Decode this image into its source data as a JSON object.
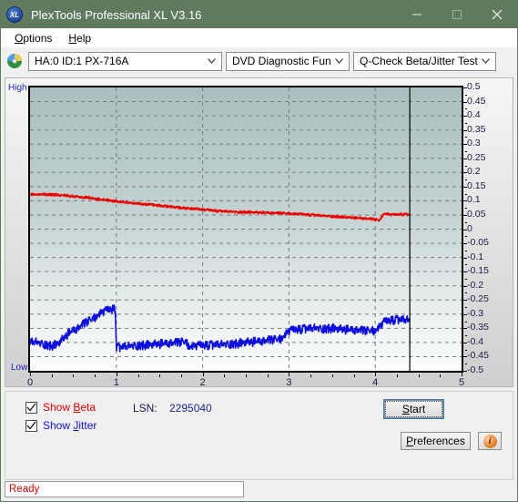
{
  "window": {
    "title": "PlexTools Professional XL V3.16",
    "app_icon": "xl-logo-icon",
    "minimize_label": "Minimize",
    "maximize_label": "Maximize",
    "close_label": "Close",
    "titlebar_color": "#5f7a5f"
  },
  "menu": {
    "items": [
      {
        "label": "Options",
        "accel": "O"
      },
      {
        "label": "Help",
        "accel": "H"
      }
    ]
  },
  "toolbar": {
    "drive_icon": "optical-disc-icon",
    "drive_select": {
      "value": "HA:0 ID:1  PX-716A"
    },
    "function_select": {
      "value": "DVD Diagnostic Functions"
    },
    "test_select": {
      "value": "Q-Check Beta/Jitter Test"
    },
    "arrow_glyph": "⌄"
  },
  "chart_data": {
    "type": "line",
    "title": "Q-Check Beta/Jitter Test",
    "xlabel": "",
    "ylabel": "",
    "xlim": [
      0,
      5
    ],
    "ylim": [
      -0.5,
      0.5
    ],
    "xticks": [
      0,
      1,
      2,
      3,
      4,
      5
    ],
    "yticks": [
      0.5,
      0.45,
      0.4,
      0.35,
      0.3,
      0.25,
      0.2,
      0.15,
      0.1,
      0.05,
      0,
      -0.05,
      -0.1,
      -0.15,
      -0.2,
      -0.25,
      -0.3,
      -0.35,
      -0.4,
      -0.45,
      -0.5
    ],
    "ytick_labels": [
      "0.5",
      "0.45",
      "0.4",
      "0.35",
      "0.3",
      "0.25",
      "0.2",
      "0.15",
      "0.1",
      "0.05",
      "0",
      "-0.05",
      "-0.1",
      "-0.15",
      "-0.2",
      "-0.25",
      "-0.3",
      "-0.35",
      "-0.4",
      "-0.45",
      "-0.5"
    ],
    "axis_top_label": "High",
    "axis_bottom_label": "Low",
    "grid": true,
    "legend": "none",
    "data_end_x": 4.4,
    "marker_x": 4.4,
    "series": [
      {
        "name": "Beta",
        "color": "#ee0000",
        "x": [
          0.0,
          0.1,
          0.2,
          0.3,
          0.4,
          0.5,
          0.6,
          0.7,
          0.8,
          0.9,
          1.0,
          1.1,
          1.2,
          1.3,
          1.4,
          1.5,
          1.6,
          1.7,
          1.8,
          1.9,
          2.0,
          2.1,
          2.2,
          2.3,
          2.4,
          2.5,
          2.6,
          2.7,
          2.8,
          2.9,
          3.0,
          3.1,
          3.2,
          3.3,
          3.4,
          3.5,
          3.6,
          3.7,
          3.8,
          3.9,
          4.0,
          4.05,
          4.1,
          4.2,
          4.3,
          4.4
        ],
        "y": [
          0.123,
          0.124,
          0.122,
          0.121,
          0.119,
          0.116,
          0.113,
          0.11,
          0.106,
          0.102,
          0.098,
          0.095,
          0.092,
          0.089,
          0.086,
          0.083,
          0.08,
          0.077,
          0.074,
          0.072,
          0.069,
          0.066,
          0.063,
          0.062,
          0.06,
          0.06,
          0.059,
          0.058,
          0.057,
          0.056,
          0.055,
          0.053,
          0.051,
          0.049,
          0.047,
          0.045,
          0.043,
          0.041,
          0.039,
          0.037,
          0.034,
          0.03,
          0.055,
          0.05,
          0.052,
          0.051
        ],
        "noise": 0.004
      },
      {
        "name": "Jitter",
        "color": "#0d0ddd",
        "x": [
          0.0,
          0.05,
          0.1,
          0.15,
          0.2,
          0.25,
          0.3,
          0.35,
          0.4,
          0.45,
          0.5,
          0.55,
          0.6,
          0.65,
          0.7,
          0.75,
          0.8,
          0.85,
          0.9,
          0.95,
          0.99,
          1.0,
          1.05,
          1.1,
          1.2,
          1.3,
          1.4,
          1.5,
          1.6,
          1.7,
          1.8,
          1.85,
          1.9,
          2.0,
          2.1,
          2.2,
          2.3,
          2.4,
          2.5,
          2.6,
          2.7,
          2.8,
          2.9,
          2.95,
          3.0,
          3.1,
          3.2,
          3.3,
          3.4,
          3.5,
          3.6,
          3.7,
          3.8,
          3.9,
          4.0,
          4.05,
          4.1,
          4.2,
          4.3,
          4.4
        ],
        "y": [
          -0.4,
          -0.398,
          -0.402,
          -0.405,
          -0.41,
          -0.412,
          -0.408,
          -0.398,
          -0.382,
          -0.368,
          -0.358,
          -0.352,
          -0.34,
          -0.33,
          -0.322,
          -0.312,
          -0.3,
          -0.292,
          -0.288,
          -0.284,
          -0.282,
          -0.42,
          -0.418,
          -0.415,
          -0.412,
          -0.41,
          -0.408,
          -0.406,
          -0.404,
          -0.402,
          -0.398,
          -0.415,
          -0.413,
          -0.412,
          -0.41,
          -0.408,
          -0.406,
          -0.404,
          -0.4,
          -0.398,
          -0.396,
          -0.392,
          -0.388,
          -0.375,
          -0.36,
          -0.356,
          -0.352,
          -0.35,
          -0.352,
          -0.35,
          -0.354,
          -0.356,
          -0.358,
          -0.36,
          -0.358,
          -0.345,
          -0.33,
          -0.322,
          -0.32,
          -0.322
        ],
        "noise": 0.016
      }
    ]
  },
  "controls": {
    "show_beta": {
      "label_pre": "Show ",
      "label_accel": "B",
      "label_post": "eta",
      "checked": true,
      "color": "#e00000"
    },
    "show_jitter": {
      "label_pre": "Show ",
      "label_accel": "J",
      "label_post": "itter",
      "checked": true,
      "color": "#1111dd"
    },
    "lsn_label": "LSN:",
    "lsn_value": "2295040",
    "start_button": {
      "pre": "",
      "accel": "S",
      "post": "tart",
      "focused": true
    },
    "preferences_button": {
      "pre": "",
      "accel": "P",
      "post": "references"
    },
    "info_button": {
      "icon": "info-icon",
      "glyph": "i"
    }
  },
  "status": {
    "text": "Ready"
  }
}
